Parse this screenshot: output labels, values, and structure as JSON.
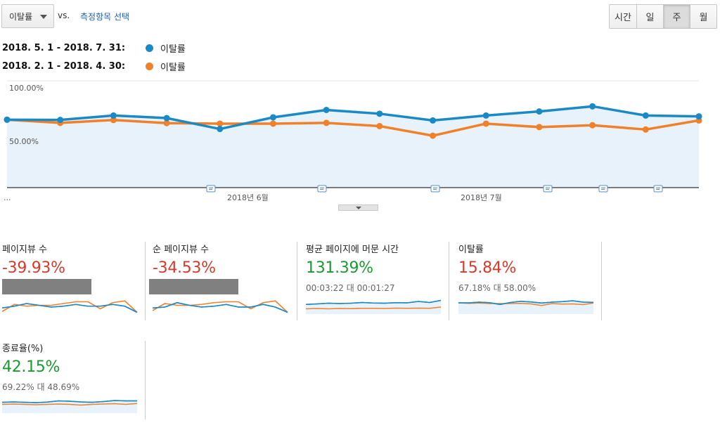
{
  "controls": {
    "metric_select": "이탈률",
    "vs_label": "vs.",
    "compare_link": "측정항목 선택",
    "range_toggle": [
      "시간",
      "일",
      "주",
      "월"
    ],
    "range_active": "주"
  },
  "legend": [
    {
      "range": "2018. 5. 1 - 2018. 7. 31:",
      "name": "이탈률",
      "color": "#1a8ac6"
    },
    {
      "range": "2018. 2. 1 - 2018. 4. 30:",
      "name": "이탈률",
      "color": "#f0802a"
    }
  ],
  "chart": {
    "ytick_top": "100.00%",
    "ytick_mid": "50.00%",
    "xtick_1": "2018년 6월",
    "xtick_2": "2018년 7월",
    "more": "..."
  },
  "chart_data": {
    "type": "line",
    "ylim": [
      0,
      100
    ],
    "series": [
      {
        "name": "이탈률",
        "color": "#1a8ac6",
        "values": [
          63.6,
          63.4,
          67.5,
          65.1,
          54.9,
          65.8,
          72.7,
          69.2,
          62.9,
          67.5,
          71.3,
          76.1,
          67.5,
          66.7
        ]
      },
      {
        "name": "이탈률",
        "color": "#f0802a",
        "values": [
          63.6,
          60.6,
          63.3,
          60.4,
          59.9,
          59.9,
          60.6,
          57.6,
          48.6,
          59.9,
          56.7,
          58.4,
          54.4,
          62.9
        ]
      }
    ],
    "annotation_markers": 6
  },
  "metrics": [
    {
      "title": "페이지뷰 수",
      "value": "-39.93%",
      "trend": "down",
      "sub": "",
      "redacted": true,
      "spark_a": [
        0.35,
        0.45,
        0.6,
        0.5,
        0.4,
        0.45,
        0.55,
        0.45,
        0.45,
        0.55,
        0.45,
        0.1
      ],
      "spark_b": [
        0.15,
        0.55,
        0.45,
        0.5,
        0.5,
        0.6,
        0.7,
        0.7,
        0.3,
        0.65,
        0.75,
        0.1
      ]
    },
    {
      "title": "순 페이지뷰 수",
      "value": "-34.53%",
      "trend": "down",
      "sub": "",
      "redacted": true,
      "spark_a": [
        0.35,
        0.4,
        0.65,
        0.5,
        0.4,
        0.45,
        0.55,
        0.4,
        0.4,
        0.55,
        0.4,
        0.1
      ],
      "spark_b": [
        0.2,
        0.6,
        0.5,
        0.5,
        0.55,
        0.65,
        0.7,
        0.7,
        0.3,
        0.65,
        0.75,
        0.1
      ]
    },
    {
      "title": "평균 페이지에 머문 시간",
      "value": "131.39%",
      "trend": "up",
      "sub": "00:03:22 대 00:01:27",
      "redacted": false,
      "spark_a": [
        0.55,
        0.58,
        0.62,
        0.6,
        0.62,
        0.66,
        0.63,
        0.62,
        0.65,
        0.64,
        0.72,
        0.66,
        0.78
      ],
      "spark_b": [
        0.3,
        0.32,
        0.3,
        0.32,
        0.31,
        0.33,
        0.33,
        0.32,
        0.34,
        0.33,
        0.34,
        0.33,
        0.4
      ]
    },
    {
      "title": "이탈률",
      "value": "15.84%",
      "trend": "down",
      "sub": "67.18% 대 58.00%",
      "redacted": false,
      "spark_a": [
        0.64,
        0.64,
        0.68,
        0.65,
        0.55,
        0.66,
        0.73,
        0.69,
        0.63,
        0.68,
        0.71,
        0.76,
        0.68,
        0.67
      ],
      "spark_b": [
        0.64,
        0.61,
        0.63,
        0.6,
        0.6,
        0.6,
        0.61,
        0.58,
        0.49,
        0.6,
        0.57,
        0.58,
        0.54,
        0.63
      ]
    },
    {
      "title": "종료율(%)",
      "value": "42.15%",
      "trend": "up",
      "sub": "69.22% 대 48.69%",
      "redacted": false,
      "spark_a": [
        0.62,
        0.64,
        0.62,
        0.6,
        0.63,
        0.7,
        0.68,
        0.64,
        0.62,
        0.66,
        0.72,
        0.7,
        0.7
      ],
      "spark_b": [
        0.5,
        0.52,
        0.5,
        0.48,
        0.5,
        0.52,
        0.5,
        0.46,
        0.5,
        0.52,
        0.54,
        0.5,
        0.55
      ]
    }
  ]
}
